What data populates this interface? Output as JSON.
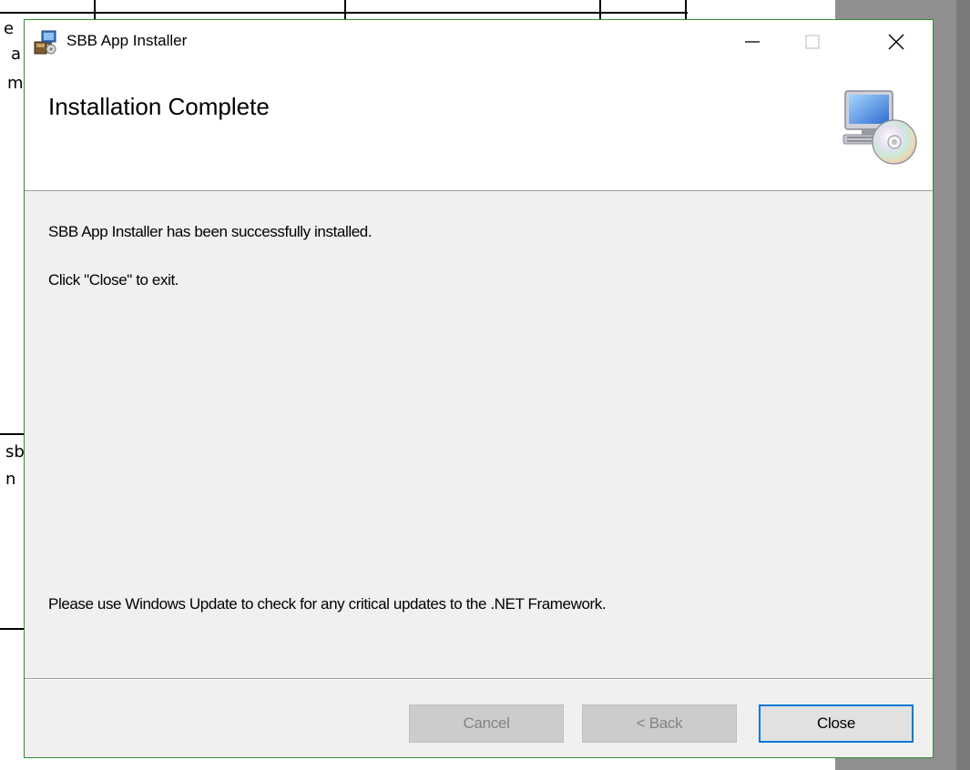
{
  "background": {
    "left_fragments": [
      "e",
      "a",
      "m",
      "sb",
      "n"
    ]
  },
  "window": {
    "title": "SBB App Installer",
    "controls": {
      "minimize": "minimize-icon",
      "maximize": "maximize-icon",
      "close": "close-icon"
    },
    "accent_color": "#0078d7",
    "frame_color": "#2f8f2f"
  },
  "header": {
    "title": "Installation Complete",
    "icon": "computer-cd-icon"
  },
  "body": {
    "success_message": "SBB App Installer has been successfully installed.",
    "instruction": "Click \"Close\" to exit.",
    "update_note": "Please use Windows Update to check for any critical updates to the .NET Framework."
  },
  "buttons": {
    "cancel": "Cancel",
    "back": "< Back",
    "close": "Close"
  }
}
